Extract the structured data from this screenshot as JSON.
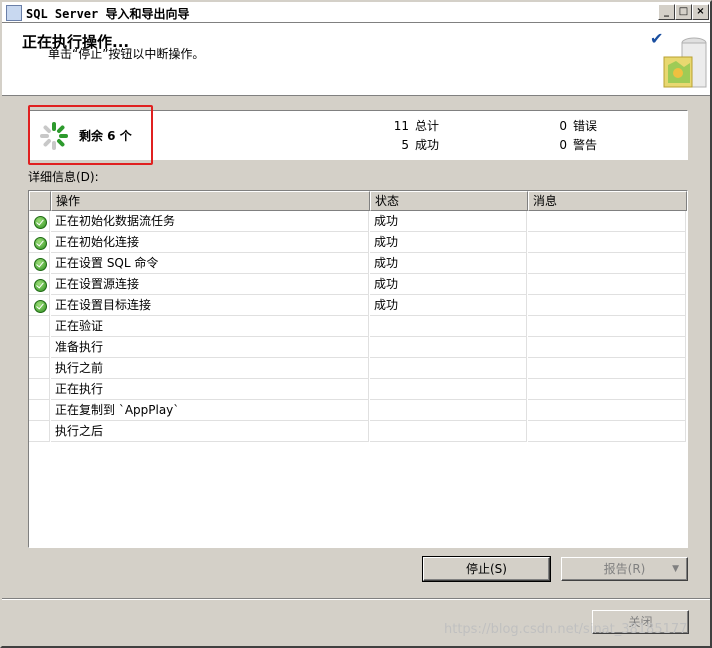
{
  "window": {
    "title": "SQL Server 导入和导出向导"
  },
  "header": {
    "title": "正在执行操作...",
    "subtitle": "单击“停止”按钮以中断操作。"
  },
  "progress": {
    "remaining": "剩余 6 个",
    "total_count": "11",
    "total_label": "总计",
    "success_count": "5",
    "success_label": "成功",
    "error_count": "0",
    "error_label": "错误",
    "warning_count": "0",
    "warning_label": "警告"
  },
  "details": {
    "label": "详细信息(D):",
    "columns": [
      "操作",
      "状态",
      "消息"
    ],
    "rows": [
      {
        "action": "正在初始化数据流任务",
        "status": "成功",
        "message": "",
        "done": true
      },
      {
        "action": "正在初始化连接",
        "status": "成功",
        "message": "",
        "done": true
      },
      {
        "action": "正在设置 SQL 命令",
        "status": "成功",
        "message": "",
        "done": true
      },
      {
        "action": "正在设置源连接",
        "status": "成功",
        "message": "",
        "done": true
      },
      {
        "action": "正在设置目标连接",
        "status": "成功",
        "message": "",
        "done": true
      },
      {
        "action": "正在验证",
        "status": "",
        "message": "",
        "done": false
      },
      {
        "action": "准备执行",
        "status": "",
        "message": "",
        "done": false
      },
      {
        "action": "执行之前",
        "status": "",
        "message": "",
        "done": false
      },
      {
        "action": "正在执行",
        "status": "",
        "message": "",
        "done": false
      },
      {
        "action": "正在复制到 `AppPlay`",
        "status": "",
        "message": "",
        "done": false
      },
      {
        "action": "执行之后",
        "status": "",
        "message": "",
        "done": false
      }
    ]
  },
  "buttons": {
    "stop": "停止(S)",
    "report": "报告(R)",
    "close": "关闭"
  },
  "watermark": "https://blog.csdn.net/sinat_38185177",
  "colors": {
    "highlight": "#e02020",
    "success": "#2d8f1f"
  }
}
